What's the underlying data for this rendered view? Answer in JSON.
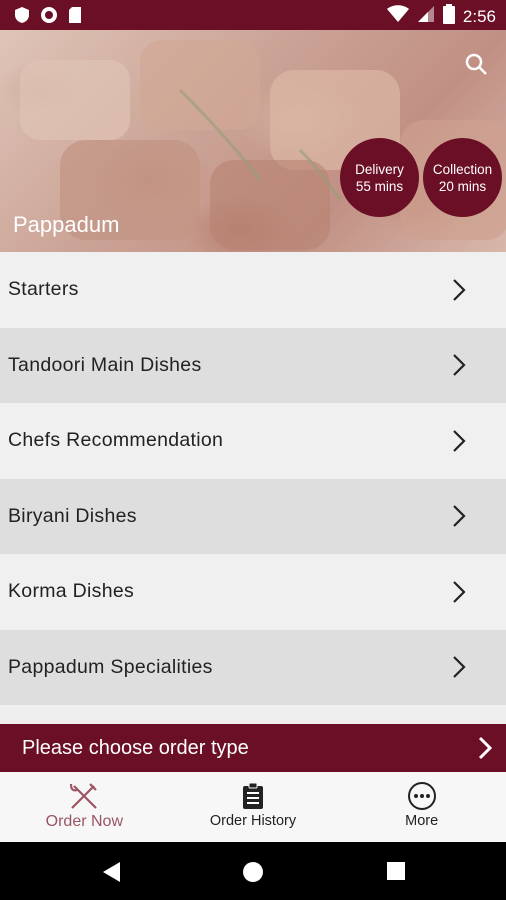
{
  "status_bar": {
    "time": "2:56",
    "icons": [
      "shield-icon",
      "circle-record-icon",
      "sd-card-icon",
      "wifi-icon",
      "signal-icon",
      "battery-icon"
    ]
  },
  "hero": {
    "restaurant_name": "Pappadum",
    "search_icon": "search-icon",
    "delivery": {
      "label": "Delivery",
      "time": "55 mins"
    },
    "collection": {
      "label": "Collection",
      "time": "20 mins"
    }
  },
  "menu": {
    "items": [
      {
        "label": "Starters"
      },
      {
        "label": "Tandoori Main Dishes"
      },
      {
        "label": "Chefs Recommendation"
      },
      {
        "label": "Biryani Dishes"
      },
      {
        "label": "Korma Dishes"
      },
      {
        "label": "Pappadum Specialities"
      }
    ]
  },
  "order_bar": {
    "label": "Please choose order type"
  },
  "tabs": [
    {
      "label": "Order Now",
      "icon": "fork-knife-icon",
      "active": true
    },
    {
      "label": "Order History",
      "icon": "clipboard-icon",
      "active": false
    },
    {
      "label": "More",
      "icon": "more-icon",
      "active": false
    }
  ],
  "colors": {
    "brand": "#6b0f26",
    "active_tab": "#9a5563"
  }
}
